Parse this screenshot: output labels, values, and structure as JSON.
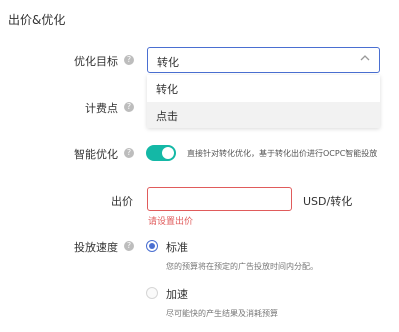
{
  "section_title": "出价&优化",
  "optimization_target": {
    "label": "优化目标",
    "value": "转化",
    "options": [
      "转化",
      "点击"
    ]
  },
  "billing_point": {
    "label": "计费点"
  },
  "smart_optimization": {
    "label": "智能优化",
    "enabled": true,
    "description": "直接针对转化优化，基于转化出价进行OCPC智能投放"
  },
  "bid": {
    "label": "出价",
    "value": "",
    "unit": "USD/转化",
    "error": "请设置出价"
  },
  "delivery_speed": {
    "label": "投放速度",
    "options": [
      {
        "title": "标准",
        "desc": "您的预算将在预定的广告投放时间内分配。",
        "selected": true
      },
      {
        "title": "加速",
        "desc": "尽可能快的产生结果及消耗预算",
        "selected": false
      }
    ]
  },
  "colors": {
    "accent": "#4a6fd1",
    "toggle_on": "#14b8a6",
    "error": "#e05b5b"
  }
}
